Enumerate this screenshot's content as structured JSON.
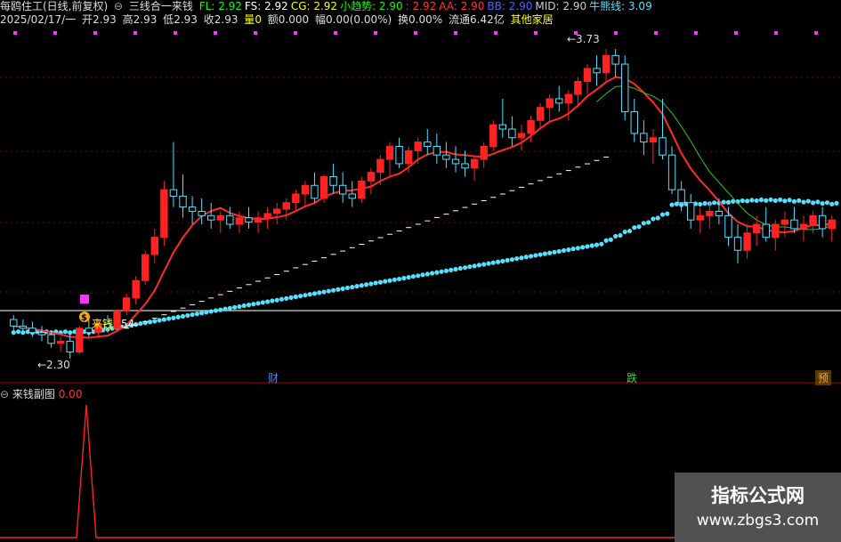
{
  "header1": {
    "title": "每鸥住工(日线,前复权)",
    "indicator_name": "三线合一来钱",
    "items": [
      {
        "label": "FL:",
        "value": "2.92",
        "color": "#00ff00"
      },
      {
        "label": "FS:",
        "value": "2.92",
        "color": "#ffffff"
      },
      {
        "label": "CG:",
        "value": "2.92",
        "color": "#ffff00"
      },
      {
        "label": "小趋势:",
        "value": "2.90",
        "color": "#00ff00"
      },
      {
        "label": ":",
        "value": "2.92",
        "color": "#ff3333"
      },
      {
        "label": "AA:",
        "value": "2.90",
        "color": "#ff3333"
      },
      {
        "label": "BB:",
        "value": "2.90",
        "color": "#4466ff"
      },
      {
        "label": "MID:",
        "value": "2.90",
        "color": "#cccccc"
      },
      {
        "label": "牛熊线:",
        "value": "3.09",
        "color": "#55e0ff"
      }
    ]
  },
  "header2": {
    "date": "2025/02/17/一",
    "open_label": "开",
    "open": "2.93",
    "high_label": "高",
    "high": "2.93",
    "low_label": "低",
    "low": "2.93",
    "close_label": "收",
    "close": "2.93",
    "vol_label": "量",
    "vol": "0",
    "amount_label": "额",
    "amount": "0.000",
    "chg_label": "幅",
    "chg": "0.00(0.00%)",
    "turnover_label": "换",
    "turnover": "0.00%",
    "float_label": "流通",
    "float": "6.42亿",
    "other": "其他家居"
  },
  "annotations": {
    "high_marker": "←3.73",
    "low_marker": "←2.30",
    "signal_text": "来钱",
    "signal_value": "54",
    "signal_icon": "$"
  },
  "event_marks": [
    {
      "text": "财",
      "color": "#4488ff"
    },
    {
      "text": "跌",
      "color": "#33dd33"
    },
    {
      "text": "预",
      "color": "#ff9933"
    }
  ],
  "subchart": {
    "title": "来钱副图",
    "value": "0.00"
  },
  "watermark": {
    "title": "指标公式网",
    "url": "www.zbgs3.com"
  },
  "colors": {
    "up": "#ff2222",
    "down": "#55e0ff",
    "ma_red": "#ff2a2a",
    "dotted": "#55e0ff",
    "grid": "#7a0000"
  },
  "price_data": {
    "description_free": true,
    "candles": [
      [
        2.48,
        2.5,
        2.43,
        2.45
      ],
      [
        2.45,
        2.48,
        2.42,
        2.44
      ],
      [
        2.44,
        2.47,
        2.4,
        2.42
      ],
      [
        2.42,
        2.45,
        2.38,
        2.41
      ],
      [
        2.41,
        2.43,
        2.35,
        2.37
      ],
      [
        2.37,
        2.4,
        2.33,
        2.38
      ],
      [
        2.38,
        2.42,
        2.3,
        2.33
      ],
      [
        2.33,
        2.45,
        2.32,
        2.44
      ],
      [
        2.44,
        2.48,
        2.4,
        2.42
      ],
      [
        2.42,
        2.48,
        2.4,
        2.46
      ],
      [
        2.46,
        2.5,
        2.42,
        2.44
      ],
      [
        2.44,
        2.52,
        2.43,
        2.52
      ],
      [
        2.52,
        2.6,
        2.5,
        2.58
      ],
      [
        2.58,
        2.68,
        2.55,
        2.66
      ],
      [
        2.66,
        2.8,
        2.64,
        2.78
      ],
      [
        2.78,
        2.9,
        2.74,
        2.86
      ],
      [
        2.86,
        3.12,
        2.82,
        3.08
      ],
      [
        3.08,
        3.3,
        3.0,
        3.05
      ],
      [
        3.05,
        3.15,
        2.95,
        3.0
      ],
      [
        3.0,
        3.05,
        2.92,
        2.98
      ],
      [
        2.98,
        3.04,
        2.92,
        2.96
      ],
      [
        2.96,
        3.02,
        2.9,
        2.94
      ],
      [
        2.94,
        2.98,
        2.88,
        2.96
      ],
      [
        2.96,
        3.0,
        2.9,
        2.92
      ],
      [
        2.92,
        2.98,
        2.88,
        2.95
      ],
      [
        2.95,
        3.0,
        2.9,
        2.93
      ],
      [
        2.93,
        2.98,
        2.88,
        2.95
      ],
      [
        2.95,
        3.0,
        2.9,
        2.97
      ],
      [
        2.97,
        3.02,
        2.92,
        2.99
      ],
      [
        2.99,
        3.04,
        2.94,
        3.02
      ],
      [
        3.02,
        3.08,
        2.98,
        3.06
      ],
      [
        3.06,
        3.12,
        3.0,
        3.1
      ],
      [
        3.1,
        3.16,
        3.02,
        3.04
      ],
      [
        3.04,
        3.15,
        3.02,
        3.14
      ],
      [
        3.14,
        3.2,
        3.06,
        3.1
      ],
      [
        3.1,
        3.16,
        3.02,
        3.06
      ],
      [
        3.06,
        3.12,
        3.0,
        3.04
      ],
      [
        3.04,
        3.14,
        3.02,
        3.12
      ],
      [
        3.12,
        3.18,
        3.06,
        3.16
      ],
      [
        3.16,
        3.24,
        3.1,
        3.22
      ],
      [
        3.22,
        3.3,
        3.14,
        3.28
      ],
      [
        3.28,
        3.32,
        3.18,
        3.2
      ],
      [
        3.2,
        3.28,
        3.16,
        3.26
      ],
      [
        3.26,
        3.32,
        3.2,
        3.3
      ],
      [
        3.3,
        3.36,
        3.24,
        3.28
      ],
      [
        3.28,
        3.34,
        3.2,
        3.24
      ],
      [
        3.24,
        3.3,
        3.18,
        3.22
      ],
      [
        3.22,
        3.28,
        3.16,
        3.2
      ],
      [
        3.2,
        3.26,
        3.14,
        3.18
      ],
      [
        3.18,
        3.24,
        3.12,
        3.22
      ],
      [
        3.22,
        3.3,
        3.18,
        3.28
      ],
      [
        3.28,
        3.4,
        3.26,
        3.38
      ],
      [
        3.38,
        3.5,
        3.32,
        3.36
      ],
      [
        3.36,
        3.42,
        3.28,
        3.32
      ],
      [
        3.32,
        3.38,
        3.26,
        3.34
      ],
      [
        3.34,
        3.42,
        3.3,
        3.4
      ],
      [
        3.4,
        3.48,
        3.36,
        3.46
      ],
      [
        3.46,
        3.52,
        3.4,
        3.5
      ],
      [
        3.5,
        3.56,
        3.44,
        3.48
      ],
      [
        3.48,
        3.54,
        3.4,
        3.52
      ],
      [
        3.52,
        3.6,
        3.46,
        3.58
      ],
      [
        3.58,
        3.66,
        3.52,
        3.64
      ],
      [
        3.64,
        3.7,
        3.56,
        3.62
      ],
      [
        3.62,
        3.73,
        3.58,
        3.7
      ],
      [
        3.7,
        3.73,
        3.6,
        3.66
      ],
      [
        3.66,
        3.7,
        3.4,
        3.44
      ],
      [
        3.44,
        3.5,
        3.3,
        3.34
      ],
      [
        3.34,
        3.4,
        3.24,
        3.3
      ],
      [
        3.3,
        3.36,
        3.2,
        3.32
      ],
      [
        3.32,
        3.5,
        3.22,
        3.24
      ],
      [
        3.24,
        3.28,
        3.06,
        3.08
      ],
      [
        3.08,
        3.12,
        2.98,
        3.02
      ],
      [
        3.02,
        3.06,
        2.9,
        2.94
      ],
      [
        2.94,
        3.0,
        2.88,
        2.96
      ],
      [
        2.96,
        3.02,
        2.9,
        2.98
      ],
      [
        2.98,
        3.04,
        2.92,
        2.96
      ],
      [
        2.96,
        3.0,
        2.82,
        2.86
      ],
      [
        2.86,
        2.92,
        2.74,
        2.8
      ],
      [
        2.8,
        2.92,
        2.76,
        2.88
      ],
      [
        2.88,
        2.96,
        2.82,
        2.92
      ],
      [
        2.92,
        3.0,
        2.84,
        2.86
      ],
      [
        2.86,
        2.94,
        2.8,
        2.92
      ],
      [
        2.92,
        2.98,
        2.86,
        2.94
      ],
      [
        2.94,
        3.0,
        2.88,
        2.9
      ],
      [
        2.9,
        2.96,
        2.84,
        2.92
      ],
      [
        2.92,
        2.98,
        2.88,
        2.96
      ],
      [
        2.96,
        3.0,
        2.86,
        2.9
      ],
      [
        2.9,
        2.96,
        2.84,
        2.94
      ]
    ]
  }
}
